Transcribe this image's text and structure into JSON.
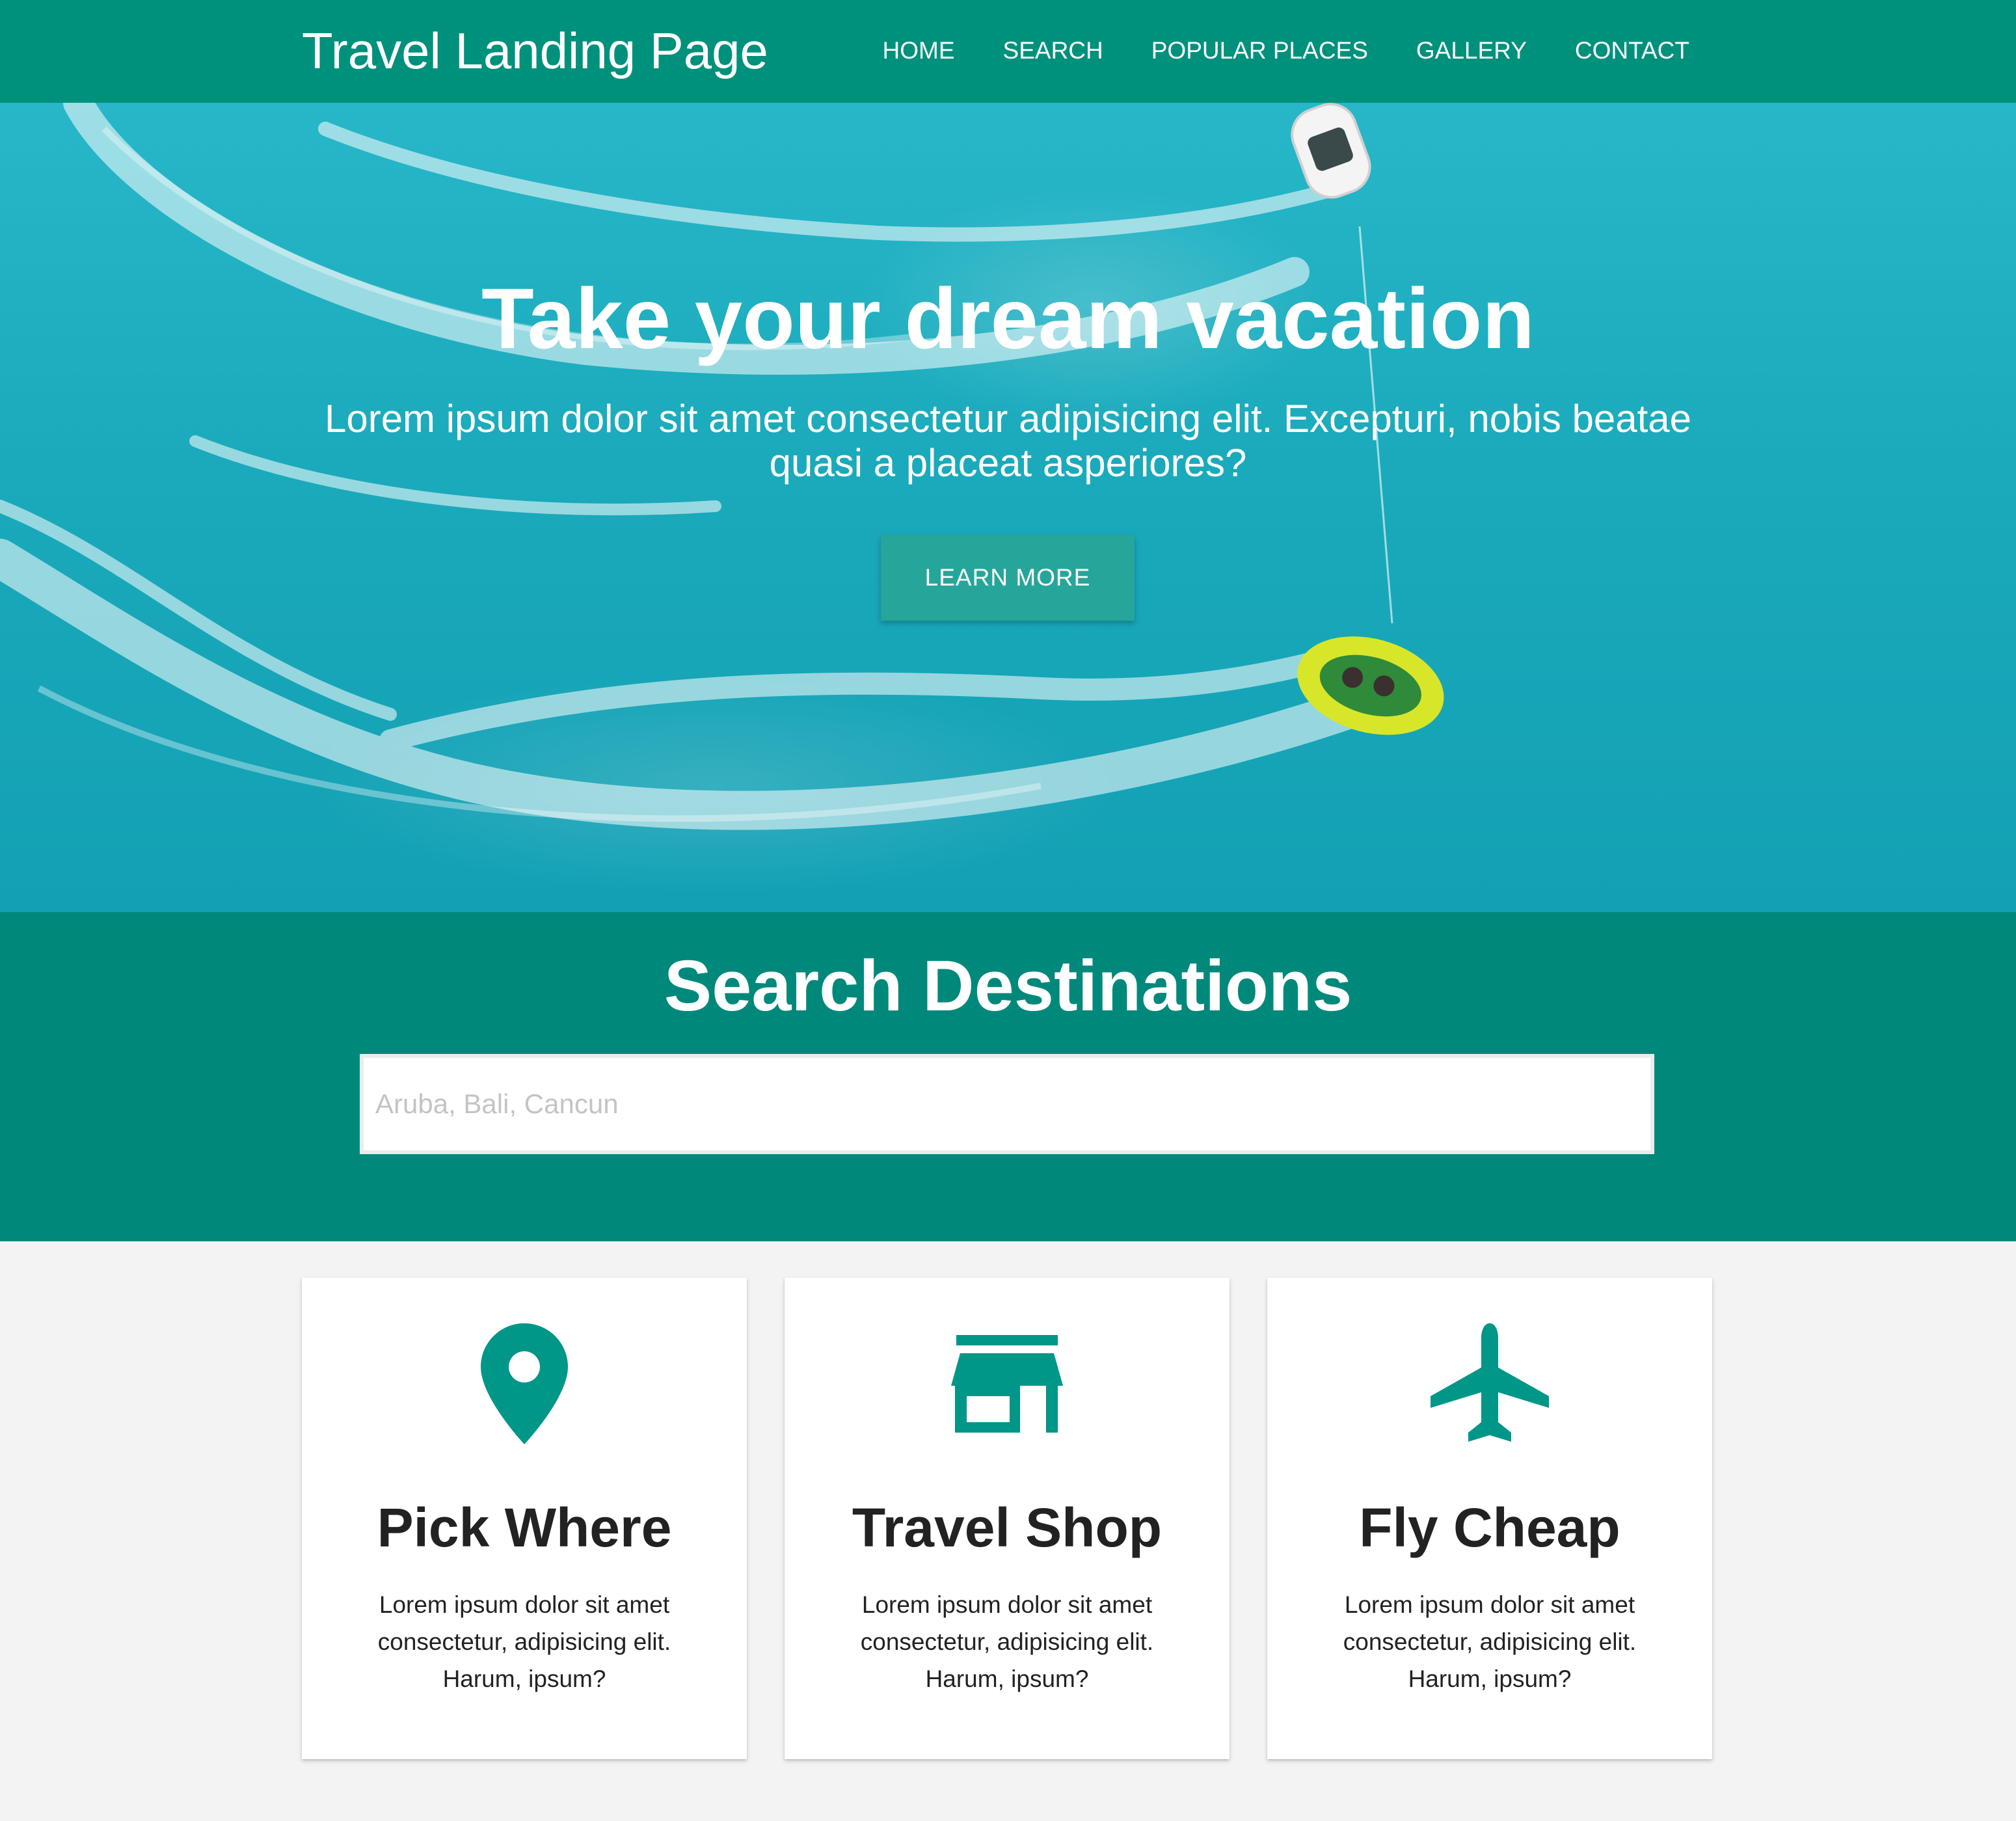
{
  "navbar": {
    "brand": "Travel Landing Page",
    "links": [
      "HOME",
      "SEARCH",
      "POPULAR PLACES",
      "GALLERY",
      "CONTACT"
    ]
  },
  "hero": {
    "title": "Take your dream vacation",
    "subtitle": "Lorem ipsum dolor sit amet consectetur adipisicing elit. Excepturi, nobis beatae quasi a placeat asperiores?",
    "button": "LEARN MORE"
  },
  "search": {
    "title": "Search Destinations",
    "placeholder": "Aruba, Bali, Cancun"
  },
  "cards": [
    {
      "icon": "map-pin-icon",
      "title": "Pick Where",
      "text": "Lorem ipsum dolor sit amet consectetur, adipisicing elit. Harum, ipsum?"
    },
    {
      "icon": "store-icon",
      "title": "Travel Shop",
      "text": "Lorem ipsum dolor sit amet consectetur, adipisicing elit. Harum, ipsum?"
    },
    {
      "icon": "airplane-icon",
      "title": "Fly Cheap",
      "text": "Lorem ipsum dolor sit amet consectetur, adipisicing elit. Harum, ipsum?"
    }
  ],
  "colors": {
    "primary": "#00917c",
    "search_bg": "#00897b",
    "button": "#26a69a",
    "icon": "#009688",
    "page_bg": "#f3f3f3"
  }
}
